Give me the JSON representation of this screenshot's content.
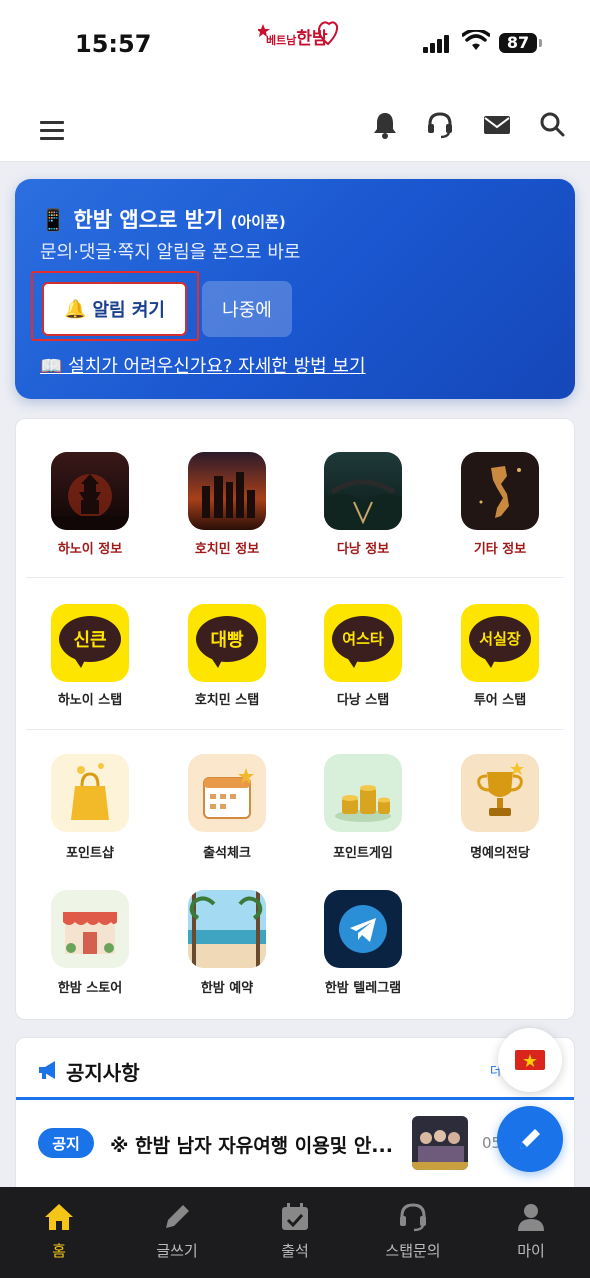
{
  "status_bar": {
    "time": "15:57",
    "battery": "87"
  },
  "header": {
    "logo_text_small": "베트남",
    "logo_text_big": "한밤",
    "icons": [
      "menu-icon",
      "bell-icon",
      "headset-icon",
      "mail-icon",
      "search-icon"
    ]
  },
  "app_banner": {
    "title": "📱 한밤 앱으로 받기",
    "title_suffix": "(아이폰)",
    "subtitle": "문의·댓글·쪽지 알림을 폰으로 바로",
    "enable_button": "알림 켜기",
    "later_button": "나중에",
    "install_link": "📖 설치가 어려우신가요? 자세한 방법 보기"
  },
  "grid": {
    "row1": [
      {
        "label": "하노이 정보",
        "icon": "hanoi-info-icon"
      },
      {
        "label": "호치민 정보",
        "icon": "hochiminh-info-icon"
      },
      {
        "label": "다낭 정보",
        "icon": "danang-info-icon"
      },
      {
        "label": "기타 정보",
        "icon": "other-info-icon"
      }
    ],
    "row2": [
      {
        "label": "하노이 스탭",
        "badge": "신큰"
      },
      {
        "label": "호치민 스탭",
        "badge": "대빵"
      },
      {
        "label": "다낭 스탭",
        "badge": "여스타"
      },
      {
        "label": "투어 스탭",
        "badge": "서실장"
      }
    ],
    "row3": [
      {
        "label": "포인트샵",
        "icon": "shopping-bag-icon"
      },
      {
        "label": "출석체크",
        "icon": "calendar-icon"
      },
      {
        "label": "포인트게임",
        "icon": "coins-icon"
      },
      {
        "label": "명예의전당",
        "icon": "trophy-icon"
      }
    ],
    "row4": [
      {
        "label": "한밤 스토어",
        "icon": "store-icon"
      },
      {
        "label": "한밤 예약",
        "icon": "beach-icon"
      },
      {
        "label": "한밤 텔레그램",
        "icon": "telegram-icon"
      }
    ]
  },
  "notice": {
    "title": "공지사항",
    "more": "더",
    "items": [
      {
        "badge": "공지",
        "text": "※ 한밤 남자 자유여행 이용및 안...",
        "date": "05"
      }
    ]
  },
  "tabbar": [
    {
      "label": "홈",
      "active": true
    },
    {
      "label": "글쓰기"
    },
    {
      "label": "출석"
    },
    {
      "label": "스탭문의"
    },
    {
      "label": "마이"
    }
  ],
  "colors": {
    "accent": "#1a73e8",
    "banner": "#1a56cf",
    "kakao": "#fee500",
    "active_tab": "#f5c518"
  }
}
